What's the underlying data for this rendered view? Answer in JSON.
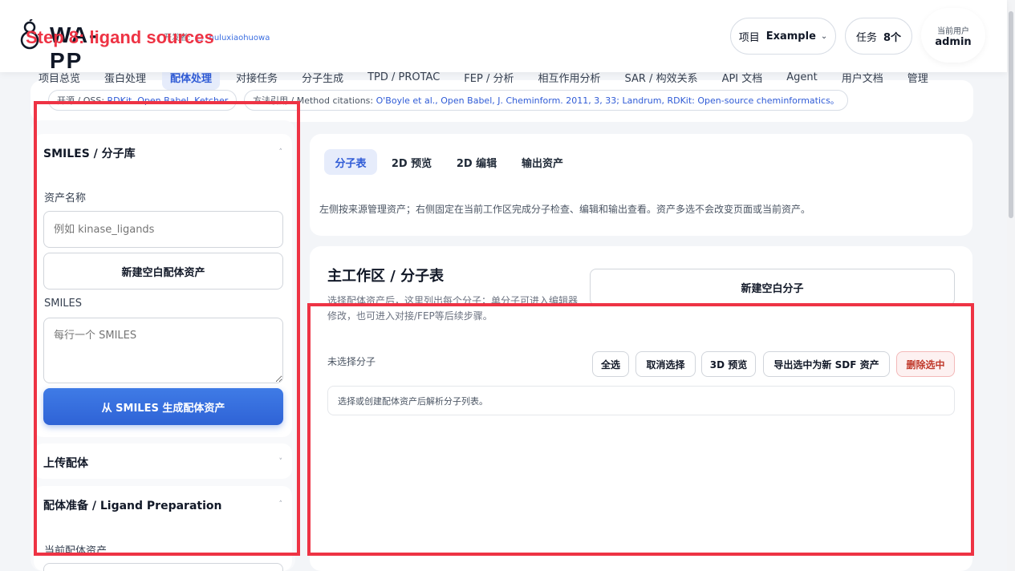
{
  "overlay": {
    "step_label": "Step 8: ligand sources"
  },
  "header": {
    "logo_text": "WA-PP",
    "developer_label": "开发者:",
    "developer_name": "huluxiaohuowa",
    "project_label": "项目",
    "project_value": "Example",
    "tasks_label": "任务",
    "tasks_value": "8个",
    "current_user_label": "当前用户",
    "current_user_name": "admin"
  },
  "nav": {
    "items": [
      {
        "label": "项目总览"
      },
      {
        "label": "蛋白处理"
      },
      {
        "label": "配体处理",
        "active": true
      },
      {
        "label": "对接任务"
      },
      {
        "label": "分子生成"
      },
      {
        "label": "TPD / PROTAC"
      },
      {
        "label": "FEP / 分析"
      },
      {
        "label": "相互作用分析"
      },
      {
        "label": "SAR / 构效关系"
      },
      {
        "label": "API 文档"
      },
      {
        "label": "Agent"
      },
      {
        "label": "用户文档"
      },
      {
        "label": "管理"
      }
    ]
  },
  "citations": {
    "oss_prefix": "开源 / OSS:",
    "oss_value": "RDKit, Open Babel, Ketcher",
    "method_prefix": "方法引用 / Method citations:",
    "method_value": "O'Boyle et al., Open Babel, J. Cheminform. 2011, 3, 33; Landrum, RDKit: Open-source cheminformatics。"
  },
  "left": {
    "smiles_section_title": "SMILES / 分子库",
    "asset_name_label": "资产名称",
    "asset_name_placeholder": "例如 kinase_ligands",
    "new_blank_asset_button": "新建空白配体资产",
    "smiles_label": "SMILES",
    "smiles_placeholder": "每行一个 SMILES",
    "generate_button": "从 SMILES 生成配体资产",
    "upload_section_title": "上传配体",
    "prep_section_title": "配体准备 / Ligand Preparation",
    "current_asset_label": "当前配体资产"
  },
  "tabs": {
    "items": [
      "分子表",
      "2D 预览",
      "2D 编辑",
      "输出资产"
    ],
    "active_index": 0,
    "description": "左侧按来源管理资产；右侧固定在当前工作区完成分子检查、编辑和输出查看。资产多选不会改变页面或当前资产。"
  },
  "main": {
    "title": "主工作区 / 分子表",
    "subtitle": "选择配体资产后，这里列出每个分子；单分子可进入编辑器修改，也可进入对接/FEP等后续步骤。",
    "new_blank_molecule_button": "新建空白分子",
    "selection_status": "未选择分子",
    "select_all": "全选",
    "deselect": "取消选择",
    "preview_3d": "3D 预览",
    "export_sdf": "导出选中为新 SDF 资产",
    "delete_selected": "删除选中",
    "empty_message": "选择或创建配体资产后解析分子列表。"
  },
  "colors": {
    "accent": "#2f5bd6",
    "highlight_red": "#ee3344",
    "danger": "#c0392b"
  }
}
